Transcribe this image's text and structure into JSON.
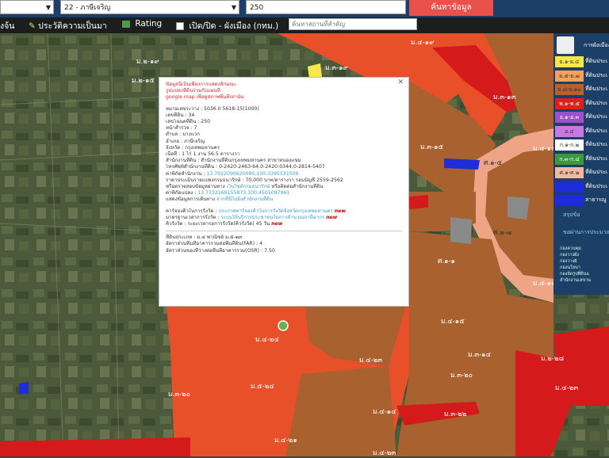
{
  "search": {
    "select1": "",
    "select2": "22 - ภาษีเจริญ",
    "input": "250",
    "button": "ค้นหาข้อมูล"
  },
  "toolbar": {
    "item1": "งจ้น",
    "history": "ประวัติความเป็นมา",
    "rating": "Rating",
    "toggle": "เปิด/ปิด - ผังเมือง (กทม.)",
    "place_placeholder": "ค้นหาสถานที่สำคัญ"
  },
  "map_labels": {
    "a1": "ม.๔-๑๙",
    "a2": "ม.๓-๑๙",
    "a3": "ม.๒-๑๙",
    "a4": "ม.๒-๑๕",
    "a5": "ม.๓-๑๓",
    "a6": "ม.๓-๑๕",
    "a7": "ศ.๑-๕",
    "a8": "ศ.๒-๗",
    "a9": "ศ.๑-๑",
    "a10": "ม.๔-๑๓",
    "a11": "ม.๔-๑๘",
    "a12": "ม.๔-๒๔",
    "a13": "ม.๔-๒๓",
    "a14": "ม.๕-๒๔",
    "a15": "ม.๓-๒๐",
    "a16": "ม.๓-๒๒",
    "a17": "ม.๔-๒๑",
    "a18": "ม.๔-๑๔",
    "a19": "ม.๒-๒๘",
    "a20": "ม.๔-๒๓",
    "a21": "ม.๓-๒๐",
    "a22": "ม.๔-๑๕",
    "a23": "ม.๔-๒๓",
    "a24": "ม.๓-๑๔"
  },
  "popup": {
    "note1": "ข้อมูลนี้เป็นเพียงการแสดงลักษณะ",
    "note2": "รูปแปลงที่ดินร่วมกับแผนที่",
    "note3": "google map เพื่อดูสภาพพื้นที่เท่านั้น",
    "map_no": "หมายเลขระวาง : 5036 II 5618-15(1000)",
    "parcel": "เลขที่ดิน : 34",
    "deed": "เลขโฉนดที่ดิน : 250",
    "survey": "หน้าสำรวจ : 7",
    "tambon": "ตำบล : บางแวก",
    "amphoe": "อำเภอ : ภาษีเจริญ",
    "province": "จังหวัด : กรุงเทพมหานคร",
    "area": "เนื้อที่ : 1 ไร่ 1 งาน 56.5 ตารางวา",
    "office": "สำนักงานที่ดิน : สำนักงานที่ดินกรุงเทพมหานคร สาขาหนองแขม",
    "phone": "โทรศัพท์สำนักงานที่ดิน : 0-2420-2463-64,0-2420-0344,0-2814-5407",
    "office_coord_label": "ค่าพิกัดสำนักงาน : ",
    "office_coord": "13.7022090620095,100.3395531509",
    "price": "ราคาประเมินรายแปลงกรมธนารักษ์ : 70,000 บาท/ตารางวา รอบบัญชี 2559-2562",
    "price_check1": "หรือตรวจสอบข้อมูลผ่านทาง ",
    "price_link": "เว็บไซต์กรมธนารักษ์",
    "price_check2": " หรือติดต่อสำนักงานที่ดิน",
    "parcel_coord_label": "ค่าพิกัดแปลง : ",
    "parcel_coord": "13.7332169155873,100.4501097961",
    "route_label": "แสดงข้อมูลการเดินทาง ",
    "route_link": "จากที่นี่ไปยังสำนักงานที่ดิน",
    "queue_label": "คาร์จองคิวในการรังวัด : ",
    "queue_link": "ประกาศคาร์จองคิวในการรังวัดจังหวัดกรุงเทพมหานคร",
    "standard_label": "มาตรฐานเวลาการรังวัด : ",
    "standard_link": "ระบบให้บริการประชาชนในการคำนวณภาษีอากร",
    "wait": "คิวรังวัด : ระยะเวลารอการรังวัด(คิวรังวัด) 45 วัน",
    "new": "new",
    "zone": "ที่ดินประเภท : ม.๔ พาณิชย์ ม.๕-๒๓",
    "far": "อัตราส่วนพื้นที่อาคารรวมต่อพื้นที่ดิน(FAR) : 4",
    "osr": "อัตราส่วนของที่ว่างต่อพื้นที่อาคารรวม(OSR) : 7.50"
  },
  "legend": {
    "title": "การผังเมือง",
    "rows": [
      {
        "code": "ย.๑-ย.๔",
        "text": "ที่ดินประเ",
        "color": "#f5e94a"
      },
      {
        "code": "ย.๕-ย.๗",
        "text": "ที่ดินประเ",
        "color": "#f4a25a"
      },
      {
        "code": "ย.๘-ย.๑๐",
        "text": "ที่ดินประเ",
        "color": "#b8612b"
      },
      {
        "code": "พ.๑-พ.๕",
        "text": "ที่ดินประเ",
        "color": "#e01e1e"
      },
      {
        "code": "อ.๑-อ.๓",
        "text": "ที่ดินประเ",
        "color": "#9b52c9"
      },
      {
        "code": "อ.๔",
        "text": "ที่ดินประเ",
        "color": "#c878e0"
      },
      {
        "code": "ก.๑-ก.๒",
        "text": "ที่ดินประเ",
        "color": "#ffffff"
      },
      {
        "code": "ก.๓-ก.๔",
        "text": "ที่ดินประเ",
        "color": "#3a9a3a"
      },
      {
        "code": "ศ.๑-ศ.๒",
        "text": "ที่ดินประเ",
        "color": "#f2b8a0"
      },
      {
        "code": "",
        "text": "ที่ดินประเ",
        "color": "#1e2dd8"
      },
      {
        "code": "",
        "text": "สาธารณู",
        "color": "#1e2dd8"
      }
    ],
    "link1": "สรุปข้อ",
    "link2": "ขอผ่านการประมาณ",
    "small": [
      "กองควบคุม",
      "กองวางผัง",
      "กองวางผั",
      "กองนโยบา",
      "กองจัดรูปที่ดินแ",
      "สำนักงานเลขาน"
    ]
  }
}
